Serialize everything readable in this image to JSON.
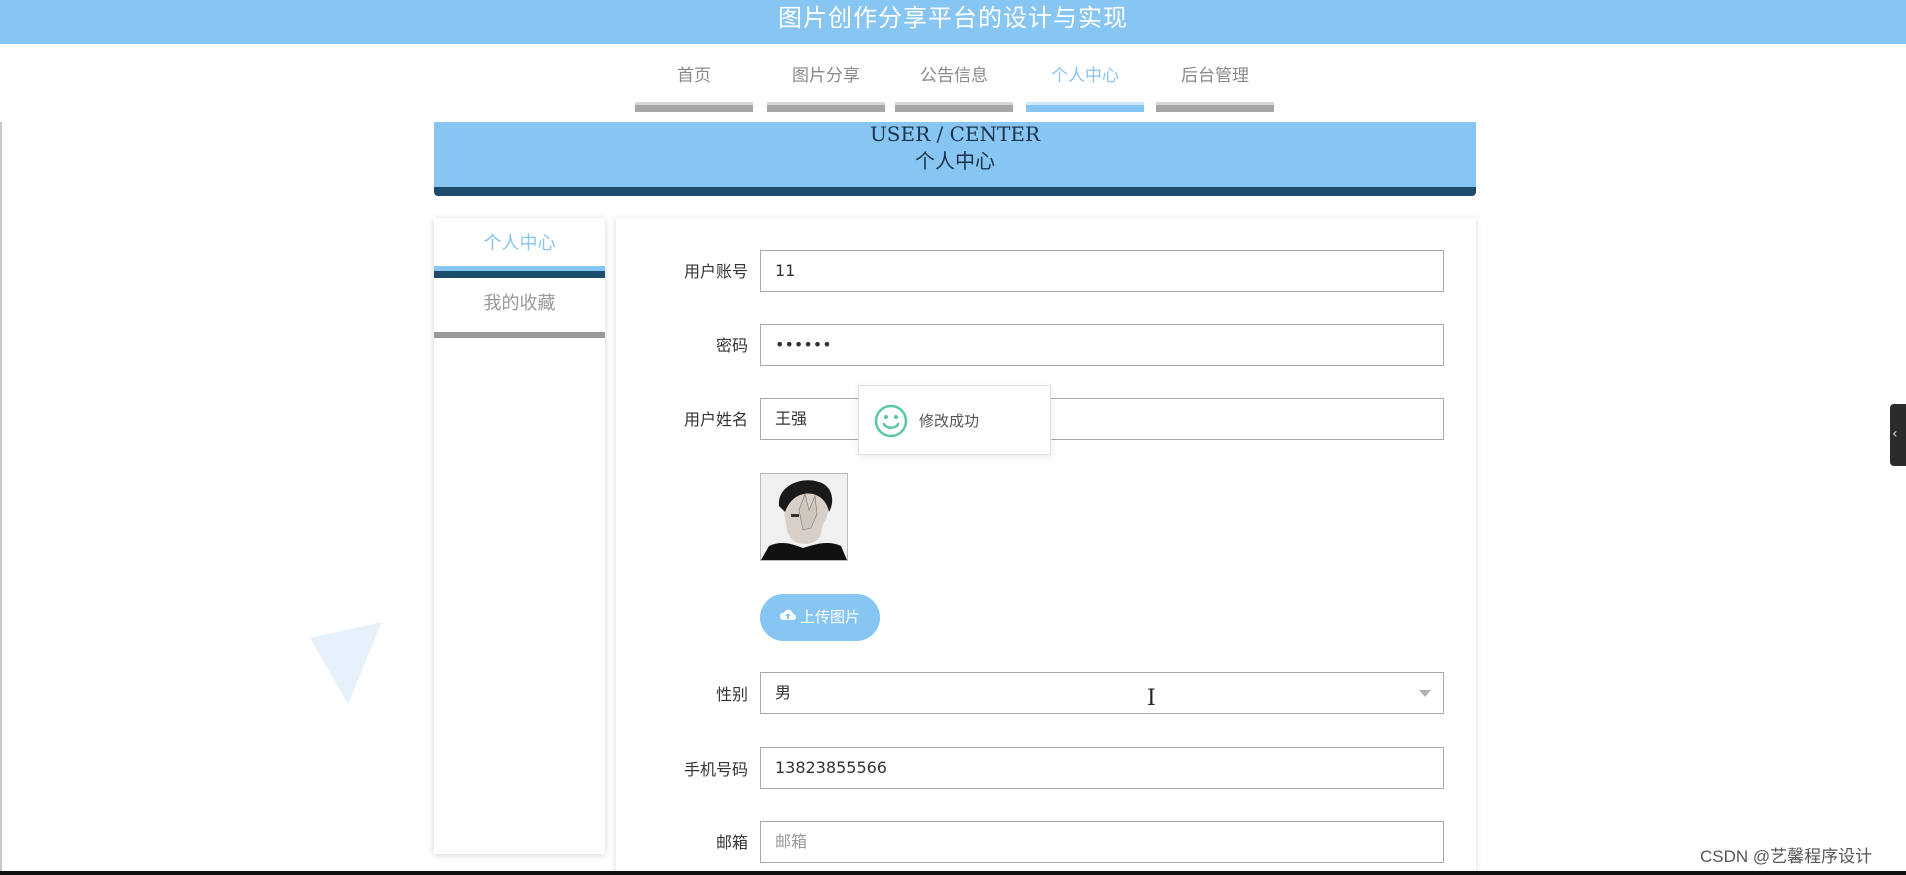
{
  "header": {
    "title": "图片创作分享平台的设计与实现"
  },
  "nav": {
    "items": [
      {
        "label": "首页",
        "active": false
      },
      {
        "label": "图片分享",
        "active": false
      },
      {
        "label": "公告信息",
        "active": false
      },
      {
        "label": "个人中心",
        "active": true
      },
      {
        "label": "后台管理",
        "active": false
      }
    ]
  },
  "banner": {
    "en": "USER / CENTER",
    "cn": "个人中心"
  },
  "sidebar": {
    "items": [
      {
        "label": "个人中心",
        "active": true
      },
      {
        "label": "我的收藏",
        "active": false
      }
    ]
  },
  "form": {
    "account": {
      "label": "用户账号",
      "value": "11"
    },
    "password": {
      "label": "密码",
      "value": "••••••"
    },
    "name": {
      "label": "用户姓名",
      "value": "王强"
    },
    "upload": {
      "label": "上传图片",
      "icon": "cloud-upload-icon"
    },
    "gender": {
      "label": "性别",
      "value": "男"
    },
    "phone": {
      "label": "手机号码",
      "value": "13823855566"
    },
    "email": {
      "label": "邮箱",
      "placeholder": "邮箱"
    }
  },
  "toast": {
    "message": "修改成功",
    "icon": "smile-icon",
    "color": "#5ac8a0"
  },
  "colors": {
    "accent": "#87c5f3",
    "dark": "#1d4b6c"
  },
  "watermark": "CSDN @艺馨程序设计"
}
